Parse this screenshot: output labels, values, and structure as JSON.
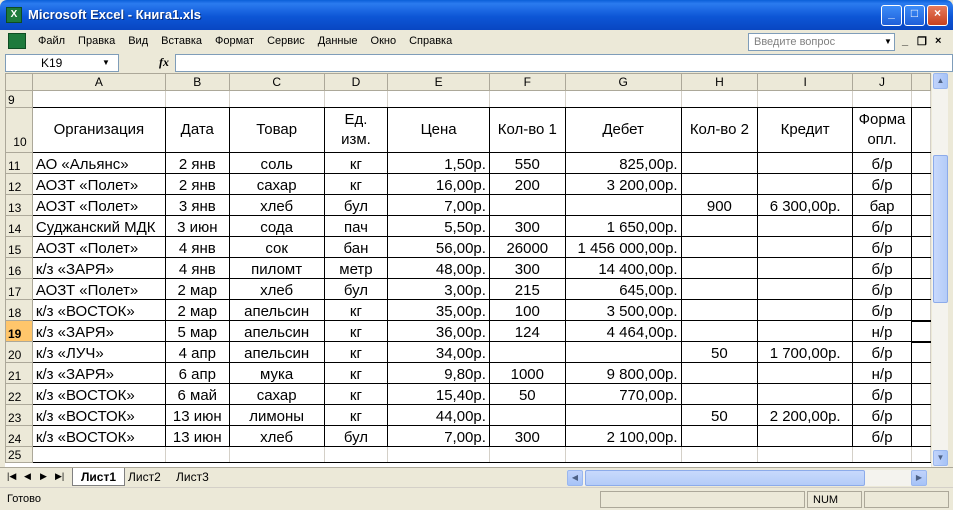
{
  "window": {
    "title": "Microsoft Excel - Книга1.xls",
    "app_icon": "excel-icon"
  },
  "menu": {
    "items": [
      "Файл",
      "Правка",
      "Вид",
      "Вставка",
      "Формат",
      "Сервис",
      "Данные",
      "Окно",
      "Справка"
    ],
    "help_placeholder": "Введите вопрос"
  },
  "formula": {
    "name_box": "K19",
    "fx": "fx",
    "content": ""
  },
  "columns": [
    "A",
    "B",
    "C",
    "D",
    "E",
    "F",
    "G",
    "H",
    "I",
    "J"
  ],
  "header_row": {
    "num": "10",
    "cells": [
      "Организация",
      "Дата",
      "Товар",
      "Ед. изм.",
      "Цена",
      "Кол-во 1",
      "Дебет",
      "Кол-во 2",
      "Кредит",
      "Форма опл."
    ]
  },
  "rows": [
    {
      "num": "11",
      "cells": [
        "АО «Альянс»",
        "2 янв",
        "соль",
        "кг",
        "1,50р.",
        "550",
        "825,00р.",
        "",
        "",
        "б/р"
      ]
    },
    {
      "num": "12",
      "cells": [
        "АОЗТ «Полет»",
        "2 янв",
        "сахар",
        "кг",
        "16,00р.",
        "200",
        "3 200,00р.",
        "",
        "",
        "б/р"
      ]
    },
    {
      "num": "13",
      "cells": [
        "АОЗТ «Полет»",
        "3 янв",
        "хлеб",
        "бул",
        "7,00р.",
        "",
        "",
        "900",
        "6 300,00р.",
        "бар"
      ]
    },
    {
      "num": "14",
      "cells": [
        "Суджанский МДК",
        "3 июн",
        "сода",
        "пач",
        "5,50р.",
        "300",
        "1 650,00р.",
        "",
        "",
        "б/р"
      ]
    },
    {
      "num": "15",
      "cells": [
        "АОЗТ «Полет»",
        "4 янв",
        "сок",
        "бан",
        "56,00р.",
        "26000",
        "1 456 000,00р.",
        "",
        "",
        "б/р"
      ]
    },
    {
      "num": "16",
      "cells": [
        "к/з «ЗАРЯ»",
        "4 янв",
        "пиломт",
        "метр",
        "48,00р.",
        "300",
        "14 400,00р.",
        "",
        "",
        "б/р"
      ]
    },
    {
      "num": "17",
      "cells": [
        "АОЗТ «Полет»",
        "2 мар",
        "хлеб",
        "бул",
        "3,00р.",
        "215",
        "645,00р.",
        "",
        "",
        "б/р"
      ]
    },
    {
      "num": "18",
      "cells": [
        "к/з «ВОСТОК»",
        "2 мар",
        "апельсин",
        "кг",
        "35,00р.",
        "100",
        "3 500,00р.",
        "",
        "",
        "б/р"
      ]
    },
    {
      "num": "19",
      "cells": [
        "к/з «ЗАРЯ»",
        "5 мар",
        "апельсин",
        "кг",
        "36,00р.",
        "124",
        "4 464,00р.",
        "",
        "",
        "н/р"
      ]
    },
    {
      "num": "20",
      "cells": [
        "к/з «ЛУЧ»",
        "4 апр",
        "апельсин",
        "кг",
        "34,00р.",
        "",
        "",
        "50",
        "1 700,00р.",
        "б/р"
      ]
    },
    {
      "num": "21",
      "cells": [
        "к/з «ЗАРЯ»",
        "6 апр",
        "мука",
        "кг",
        "9,80р.",
        "1000",
        "9 800,00р.",
        "",
        "",
        "н/р"
      ]
    },
    {
      "num": "22",
      "cells": [
        "к/з «ВОСТОК»",
        "6 май",
        "сахар",
        "кг",
        "15,40р.",
        "50",
        "770,00р.",
        "",
        "",
        "б/р"
      ]
    },
    {
      "num": "23",
      "cells": [
        "к/з «ВОСТОК»",
        "13 июн",
        "лимоны",
        "кг",
        "44,00р.",
        "",
        "",
        "50",
        "2 200,00р.",
        "б/р"
      ]
    },
    {
      "num": "24",
      "cells": [
        "к/з «ВОСТОК»",
        "13 июн",
        "хлеб",
        "бул",
        "7,00р.",
        "300",
        "2 100,00р.",
        "",
        "",
        "б/р"
      ]
    }
  ],
  "blank_rows": [
    "9",
    "25"
  ],
  "selected_row": "19",
  "sheets": [
    "Лист1",
    "Лист2",
    "Лист3"
  ],
  "active_sheet": "Лист1",
  "status": {
    "text": "Готово",
    "num": "NUM"
  },
  "colors": {
    "title_bar": "#0A5FD8",
    "selection": "#FFC66B",
    "chrome": "#ECE9D8"
  }
}
